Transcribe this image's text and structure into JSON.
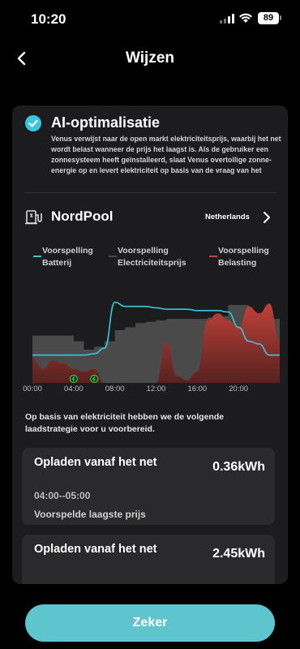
{
  "status_bar": {
    "time": "10:20",
    "battery": "89"
  },
  "nav": {
    "title": "Wijzen",
    "back_icon": "chevron-left-icon"
  },
  "ai": {
    "title": "AI-optimalisatie",
    "description": "Venus verwijst naar de open markt elektriciteitsprijs, waarbij het net wordt belast wanneer de prijs het laagst is. Als de gebruiker een zonnesysteem heeft geïnstalleerd, slaat Venus overtollige zonne-energie op en levert elektriciteit op basis van de vraag van het",
    "check_icon": "check-circle-icon"
  },
  "nordpool": {
    "title": "NordPool",
    "region": "Netherlands",
    "icon": "plug-station-icon"
  },
  "legend": [
    {
      "line1": "Voorspelling",
      "line2": "Batterij",
      "color": "#3cc6dd"
    },
    {
      "line1": "Voorspelling",
      "line2": "Electriciteitsprijs",
      "color": "#4a4a4a"
    },
    {
      "line1": "Voorspelling",
      "line2": "Belasting",
      "color": "#c8423a"
    }
  ],
  "chart_data": {
    "type": "area",
    "x": [
      0,
      1,
      2,
      3,
      4,
      5,
      6,
      7,
      8,
      9,
      10,
      11,
      12,
      13,
      14,
      15,
      16,
      17,
      18,
      19,
      20,
      21,
      22,
      23,
      24
    ],
    "xticks": [
      "00:00",
      "04:00",
      "08:00",
      "12:00",
      "16:00",
      "20:00"
    ],
    "series": [
      {
        "name": "Voorspelling Batterij",
        "color": "#3cc6dd",
        "values": [
          20,
          20,
          20,
          20,
          20,
          20,
          21,
          25,
          58,
          55,
          55,
          55,
          54,
          53,
          53,
          53,
          52,
          52,
          52,
          51,
          40,
          30,
          28,
          20,
          20
        ]
      },
      {
        "name": "Voorspelling Electriciteitsprijs",
        "color": "#4a4a4a",
        "values": [
          34,
          34,
          34,
          34,
          30,
          24,
          26,
          30,
          38,
          40,
          43,
          44,
          45,
          46,
          46,
          46,
          46,
          47,
          48,
          56,
          56,
          47,
          46,
          46,
          46
        ]
      },
      {
        "name": "Voorspelling Belasting",
        "color": "#c8423a",
        "values": [
          18,
          10,
          16,
          14,
          10,
          8,
          10,
          0,
          0,
          0,
          0,
          0,
          0,
          30,
          5,
          2,
          8,
          45,
          50,
          45,
          40,
          55,
          50,
          57,
          30
        ]
      }
    ],
    "charge_markers": [
      4,
      6
    ],
    "ylim": [
      0,
      70
    ]
  },
  "plan_intro": "Op basis van elektriciteit hebben we de volgende laadstrategie voor u voorbereid.",
  "plans": [
    {
      "title": "Opladen vanaf het net",
      "value": "0.36kWh",
      "time": "04:00--05:00",
      "note": "Voorspelde laagste prijs"
    },
    {
      "title": "Opladen vanaf het net",
      "value": "2.45kWh"
    }
  ],
  "confirm_button": "Zeker"
}
